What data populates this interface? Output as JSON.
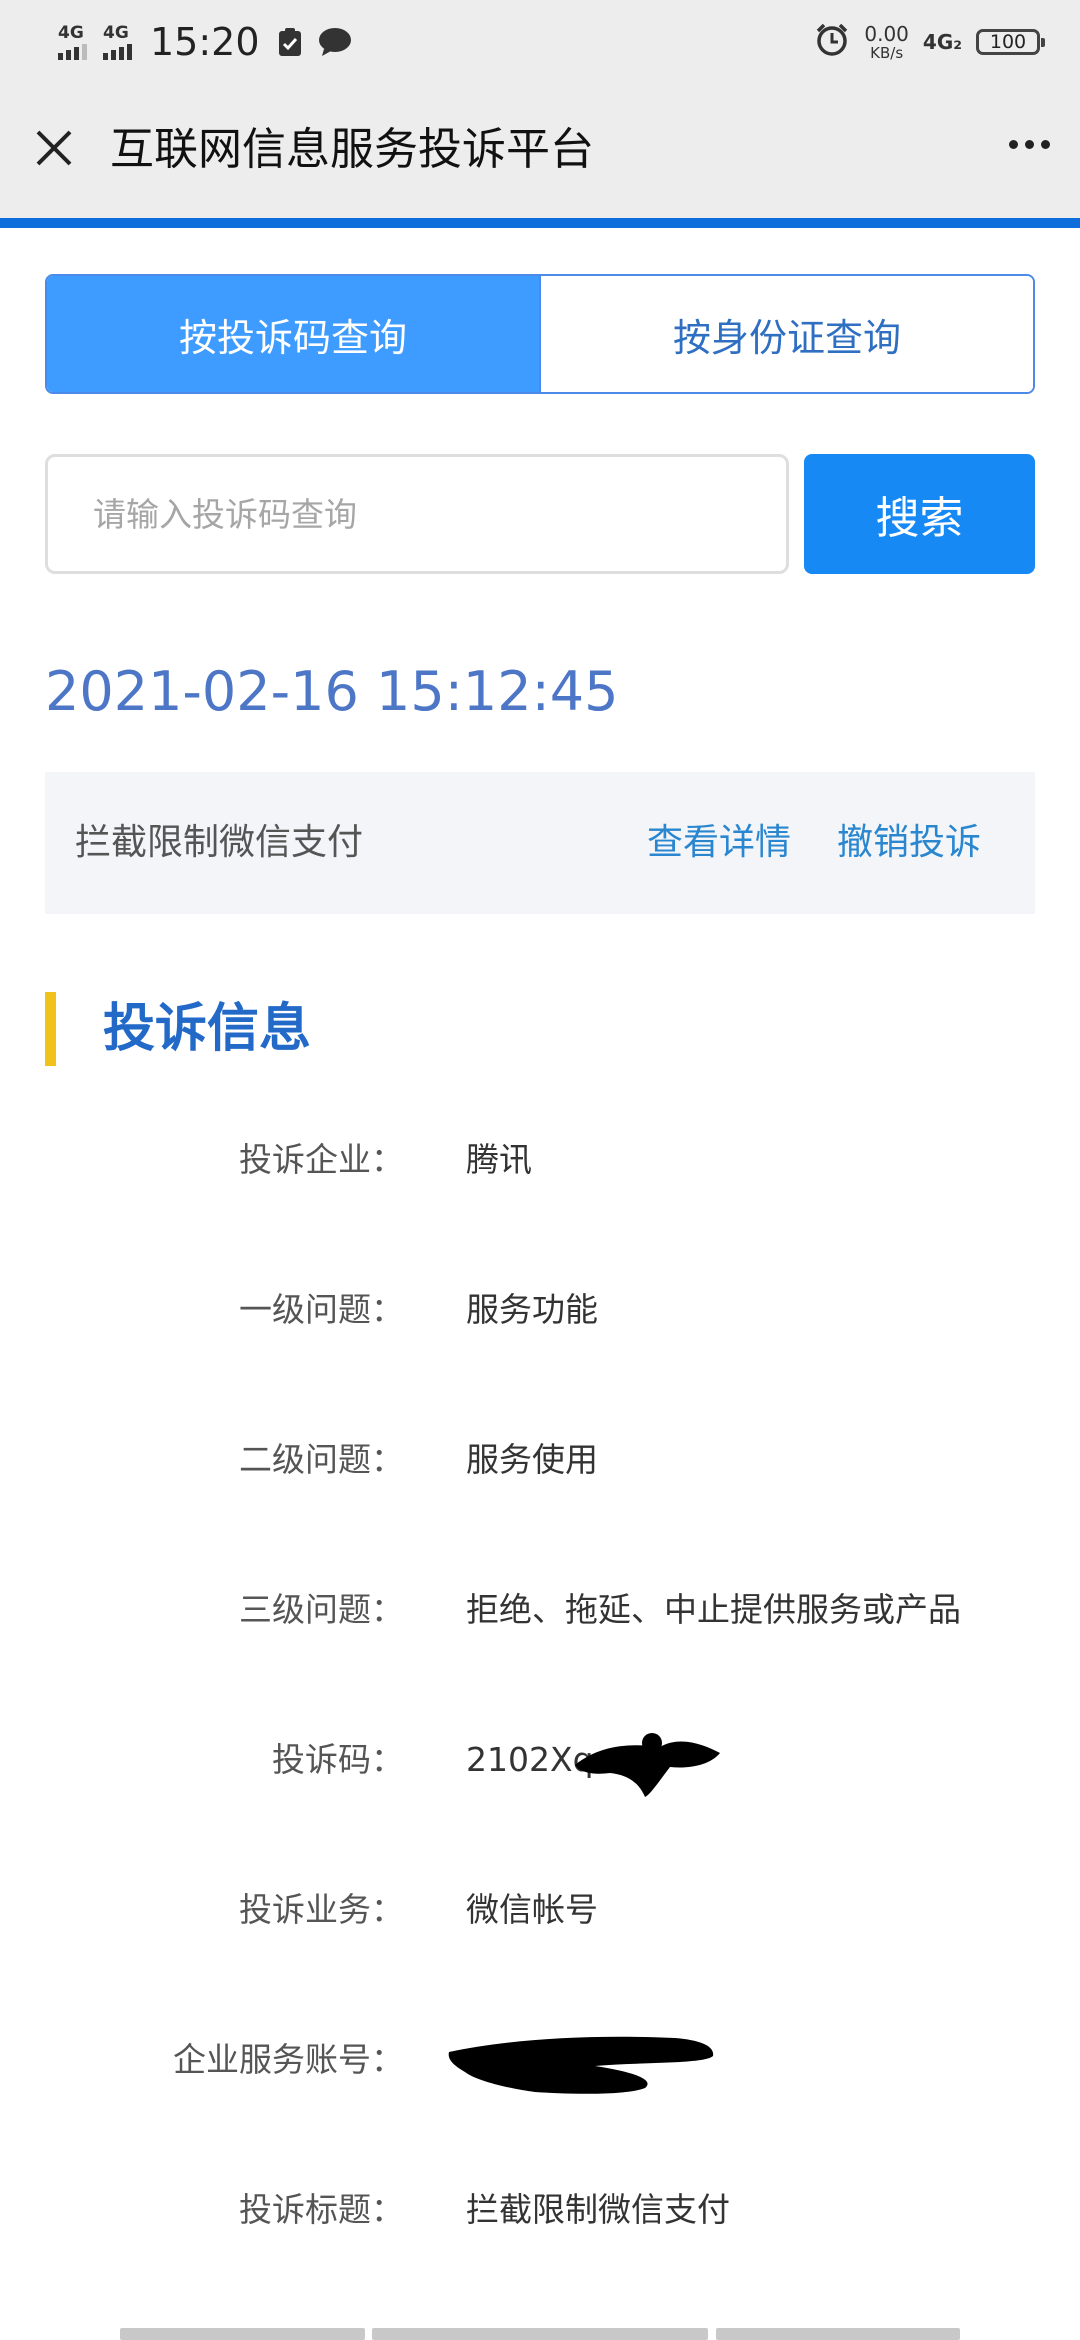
{
  "status_bar": {
    "sim1": "4G",
    "sim2": "4G",
    "time": "15:20",
    "speed_value": "0.00",
    "speed_unit": "KB/s",
    "network": "4G₂",
    "battery": "100"
  },
  "header": {
    "title": "互联网信息服务投诉平台"
  },
  "tabs": [
    {
      "label": "按投诉码查询",
      "active": true
    },
    {
      "label": "按身份证查询",
      "active": false
    }
  ],
  "search": {
    "placeholder": "请输入投诉码查询",
    "value": "",
    "button_label": "搜索"
  },
  "record": {
    "datetime": "2021-02-16 15:12:45",
    "title": "拦截限制微信支付",
    "detail_link": "查看详情",
    "cancel_link": "撤销投诉"
  },
  "section": {
    "title": "投诉信息"
  },
  "info": [
    {
      "label": "投诉企业：",
      "value": "腾讯"
    },
    {
      "label": "一级问题：",
      "value": "服务功能"
    },
    {
      "label": "二级问题：",
      "value": "服务使用"
    },
    {
      "label": "三级问题：",
      "value": "拒绝、拖延、中止提供服务或产品"
    },
    {
      "label": "投诉码：",
      "value": "2102Xqv"
    },
    {
      "label": "投诉业务：",
      "value": "微信帐号"
    },
    {
      "label": "企业服务账号：",
      "value": ""
    },
    {
      "label": "投诉标题：",
      "value": "拦截限制微信支付"
    }
  ],
  "colors": {
    "accent": "#1789f4",
    "tab_active": "#3e9bff",
    "link": "#2a86cf",
    "section_bar": "#f1c21b",
    "progress": "#0e6fdc"
  }
}
